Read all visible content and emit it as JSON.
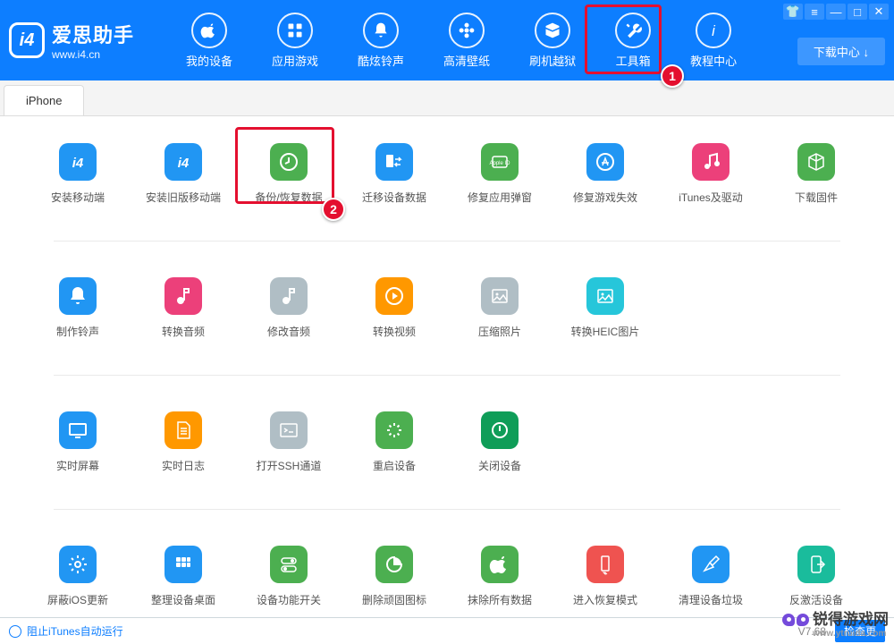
{
  "app": {
    "name": "爱思助手",
    "url": "www.i4.cn"
  },
  "nav": [
    {
      "label": "我的设备"
    },
    {
      "label": "应用游戏"
    },
    {
      "label": "酷炫铃声"
    },
    {
      "label": "高清壁纸"
    },
    {
      "label": "刷机越狱"
    },
    {
      "label": "工具箱"
    },
    {
      "label": "教程中心"
    }
  ],
  "download_center": "下载中心 ↓",
  "tab": "iPhone",
  "tools": [
    {
      "label": "安装移动端",
      "c": "c-blue",
      "i": "i4"
    },
    {
      "label": "安装旧版移动端",
      "c": "c-blue",
      "i": "i4"
    },
    {
      "label": "备份/恢复数据",
      "c": "c-green",
      "i": "clock"
    },
    {
      "label": "迁移设备数据",
      "c": "c-blue",
      "i": "transfer"
    },
    {
      "label": "修复应用弹窗",
      "c": "c-green",
      "i": "appleid"
    },
    {
      "label": "修复游戏失效",
      "c": "c-blue",
      "i": "astore"
    },
    {
      "label": "iTunes及驱动",
      "c": "c-pink",
      "i": "music"
    },
    {
      "label": "下载固件",
      "c": "c-green",
      "i": "cube"
    },
    {
      "label": "制作铃声",
      "c": "c-blue",
      "i": "bell"
    },
    {
      "label": "转换音频",
      "c": "c-pink",
      "i": "note"
    },
    {
      "label": "修改音频",
      "c": "c-gray",
      "i": "note"
    },
    {
      "label": "转换视频",
      "c": "c-orange",
      "i": "play"
    },
    {
      "label": "压缩照片",
      "c": "c-gray",
      "i": "image"
    },
    {
      "label": "转换HEIC图片",
      "c": "c-cyan",
      "i": "image"
    },
    {
      "label": "实时屏幕",
      "c": "c-blue",
      "i": "monitor"
    },
    {
      "label": "实时日志",
      "c": "c-orange",
      "i": "doc"
    },
    {
      "label": "打开SSH通道",
      "c": "c-gray",
      "i": "terminal"
    },
    {
      "label": "重启设备",
      "c": "c-green",
      "i": "loading"
    },
    {
      "label": "关闭设备",
      "c": "c-dgreen",
      "i": "power"
    },
    {
      "label": "屏蔽iOS更新",
      "c": "c-blue",
      "i": "gear"
    },
    {
      "label": "整理设备桌面",
      "c": "c-blue",
      "i": "grid"
    },
    {
      "label": "设备功能开关",
      "c": "c-green",
      "i": "toggle"
    },
    {
      "label": "删除顽固图标",
      "c": "c-green",
      "i": "pie"
    },
    {
      "label": "抹除所有数据",
      "c": "c-green",
      "i": "apple"
    },
    {
      "label": "进入恢复模式",
      "c": "c-red",
      "i": "phone"
    },
    {
      "label": "清理设备垃圾",
      "c": "c-blue",
      "i": "broom"
    },
    {
      "label": "反激活设备",
      "c": "c-teal",
      "i": "deact"
    }
  ],
  "callouts": {
    "1": "1",
    "2": "2"
  },
  "footer": {
    "block": "阻止iTunes自动运行",
    "version": "V7.68",
    "check": "检查更"
  },
  "watermark": {
    "name": "锐得游戏网",
    "url": "www.ytruida.com"
  }
}
